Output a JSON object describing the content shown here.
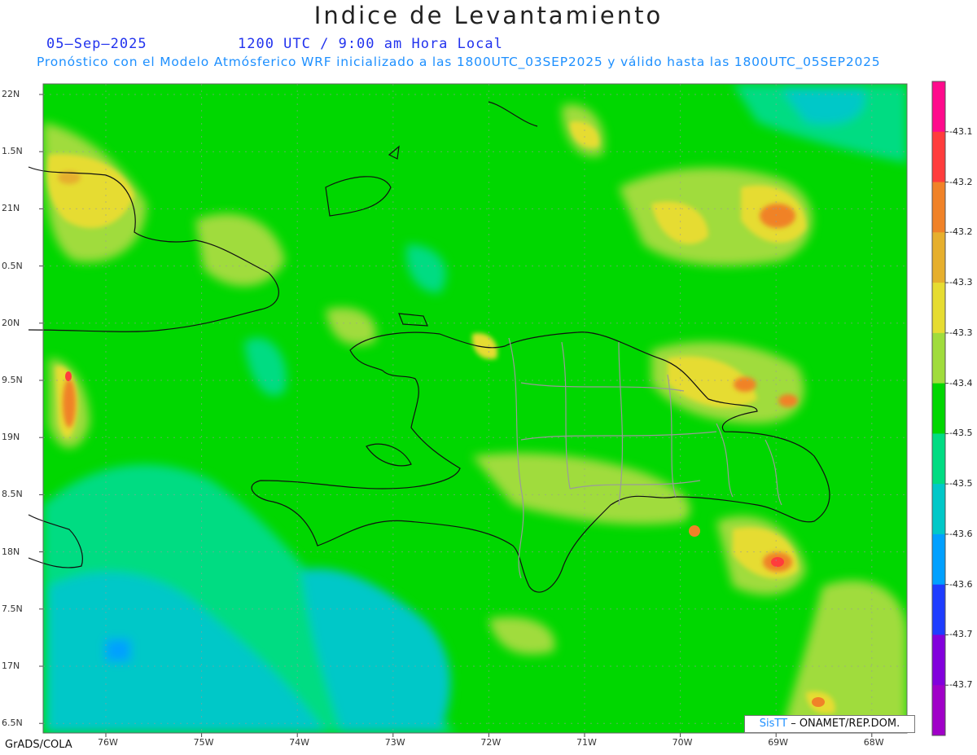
{
  "header": {
    "title": "Indice de Levantamiento",
    "date": "05–Sep–2025",
    "time": "1200 UTC / 9:00 am Hora Local",
    "description": "Pronóstico con el Modelo Atmósferico WRF inicializado a las 1800UTC_03SEP2025 y válido hasta las  1800UTC_05SEP2025"
  },
  "axes": {
    "lat_labels": [
      "22N",
      "1.5N",
      "21N",
      "0.5N",
      "20N",
      "9.5N",
      "19N",
      "8.5N",
      "18N",
      "7.5N",
      "17N",
      "6.5N"
    ],
    "lon_labels": [
      "76W",
      "75W",
      "74W",
      "73W",
      "72W",
      "71W",
      "70W",
      "69W",
      "68W"
    ]
  },
  "colorbar": {
    "labels": [
      "-43.1",
      "-43.2",
      "-43.2",
      "-43.3",
      "-43.3",
      "-43.4",
      "-43.5",
      "-43.5",
      "-43.6",
      "-43.6",
      "-43.7",
      "-43.7"
    ],
    "colors": [
      "#ff0a8c",
      "#ff3c3c",
      "#f08228",
      "#e6af2d",
      "#e6dc32",
      "#a0dc3c",
      "#00d700",
      "#00dc82",
      "#00c8c8",
      "#00a0ff",
      "#1e3cff",
      "#8200dc",
      "#a000c8"
    ]
  },
  "credits": {
    "software": "GrADS/COLA",
    "watermark_brand": "SisTT",
    "watermark_text": " – ONAMET/REP.DOM."
  }
}
